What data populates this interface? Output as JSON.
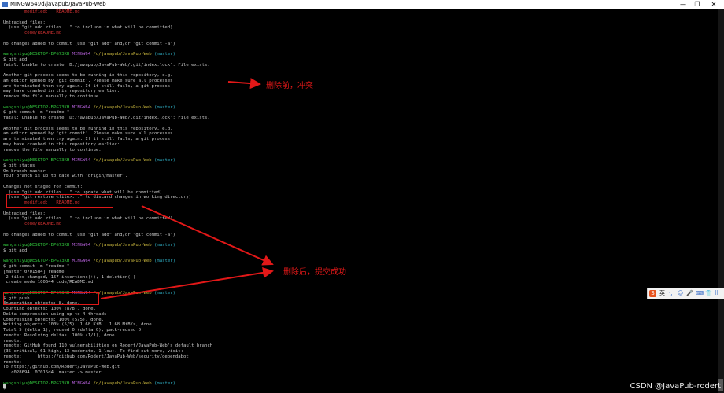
{
  "window": {
    "title": "MINGW64:/d/javapub/JavaPub-Web",
    "minimize": "—",
    "maximize": "❐",
    "close": "✕"
  },
  "prompt": {
    "user": "wangshiyu@DESKTOP-BPG73KH",
    "env": "MINGW64",
    "path": "/d/javapub/JavaPub-Web",
    "branch": "(master)"
  },
  "terminal_lines": [
    {
      "t": "        modified:   README.md",
      "c": "red"
    },
    {
      "t": ""
    },
    {
      "t": "Untracked files:"
    },
    {
      "t": "  (use \"git add <file>...\" to include in what will be committed)"
    },
    {
      "t": "        code/README.md",
      "c": "red"
    },
    {
      "t": ""
    },
    {
      "t": "no changes added to commit (use \"git add\" and/or \"git commit -a\")"
    },
    {
      "t": ""
    },
    {
      "prompt": true
    },
    {
      "t": "$ git add ."
    },
    {
      "t": "fatal: Unable to create 'D:/javapub/JavaPub-Web/.git/index.lock': File exists."
    },
    {
      "t": ""
    },
    {
      "t": "Another git process seems to be running in this repository, e.g."
    },
    {
      "t": "an editor opened by 'git commit'. Please make sure all processes"
    },
    {
      "t": "are terminated then try again. If it still fails, a git process"
    },
    {
      "t": "may have crashed in this repository earlier:"
    },
    {
      "t": "remove the file manually to continue."
    },
    {
      "t": ""
    },
    {
      "prompt": true
    },
    {
      "t": "$ git commit -m \"readme \""
    },
    {
      "t": "fatal: Unable to create 'D:/javapub/JavaPub-Web/.git/index.lock': File exists."
    },
    {
      "t": ""
    },
    {
      "t": "Another git process seems to be running in this repository, e.g."
    },
    {
      "t": "an editor opened by 'git commit'. Please make sure all processes"
    },
    {
      "t": "are terminated then try again. If it still fails, a git process"
    },
    {
      "t": "may have crashed in this repository earlier:"
    },
    {
      "t": "remove the file manually to continue."
    },
    {
      "t": ""
    },
    {
      "prompt": true
    },
    {
      "t": "$ git status"
    },
    {
      "t": "On branch master"
    },
    {
      "t": "Your branch is up to date with 'origin/master'."
    },
    {
      "t": ""
    },
    {
      "t": "Changes not staged for commit:"
    },
    {
      "t": "  (use \"git add <file>...\" to update what will be committed)"
    },
    {
      "t": "  (use \"git restore <file>...\" to discard changes in working directory)"
    },
    {
      "t": "        modified:   README.md",
      "c": "red"
    },
    {
      "t": ""
    },
    {
      "t": "Untracked files:"
    },
    {
      "t": "  (use \"git add <file>...\" to include in what will be committed)"
    },
    {
      "t": "        code/README.md",
      "c": "red"
    },
    {
      "t": ""
    },
    {
      "t": "no changes added to commit (use \"git add\" and/or \"git commit -a\")"
    },
    {
      "t": ""
    },
    {
      "prompt": true
    },
    {
      "t": "$ git add ."
    },
    {
      "t": ""
    },
    {
      "prompt": true
    },
    {
      "t": "$ git commit -m \"readme \""
    },
    {
      "t": "[master 07015d4] readme"
    },
    {
      "t": " 2 files changed, 157 insertions(+), 1 deletion(-)"
    },
    {
      "t": " create mode 100644 code/README.md"
    },
    {
      "t": ""
    },
    {
      "prompt": true
    },
    {
      "t": "$ git push"
    },
    {
      "t": "Enumerating objects: 8, done."
    },
    {
      "t": "Counting objects: 100% (8/8), done."
    },
    {
      "t": "Delta compression using up to 4 threads"
    },
    {
      "t": "Compressing objects: 100% (5/5), done."
    },
    {
      "t": "Writing objects: 100% (5/5), 1.68 KiB | 1.68 MiB/s, done."
    },
    {
      "t": "Total 5 (delta 1), reused 0 (delta 0), pack-reused 0"
    },
    {
      "t": "remote: Resolving deltas: 100% (1/1), done."
    },
    {
      "t": "remote:"
    },
    {
      "t": "remote: GitHub found 110 vulnerabilities on Rodert/JavaPub-Web's default branch"
    },
    {
      "t": "(35 critical, 61 high, 13 moderate, 1 low). To find out more, visit:"
    },
    {
      "t": "remote:      https://github.com/Rodert/JavaPub-Web/security/dependabot"
    },
    {
      "t": "remote:"
    },
    {
      "t": "To https://github.com/Rodert/JavaPub-Web.git"
    },
    {
      "t": "   c028694..07015d4  master -> master"
    },
    {
      "t": ""
    },
    {
      "prompt": true
    },
    {
      "t": "$"
    }
  ],
  "annotations": {
    "before": "删除前，冲突",
    "after": "删除后，提交成功"
  },
  "ime": {
    "logo": "S",
    "lang": "英",
    "tools": [
      "·,",
      "☺",
      "🎤",
      "⌨",
      "👕",
      "⠿"
    ]
  },
  "watermark": "CSDN @JavaPub-rodert",
  "colors": {
    "user": "#2fbf3a",
    "env": "#b25ed6",
    "path": "#c7b53d",
    "branch": "#30b3c9",
    "error": "#d23232",
    "annotation": "#e21818"
  }
}
